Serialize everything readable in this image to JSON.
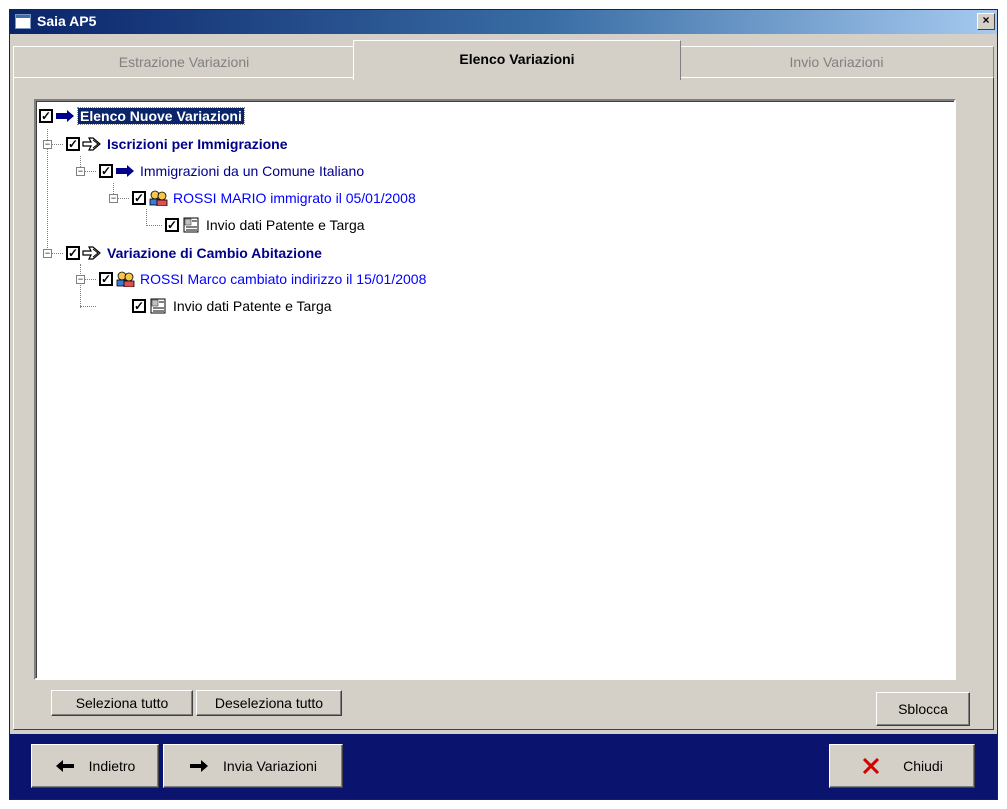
{
  "window": {
    "title": "Saia AP5",
    "close_label": "×"
  },
  "tabs": [
    {
      "label": "Estrazione Variazioni",
      "active": false
    },
    {
      "label": "Elenco Variazioni",
      "active": true
    },
    {
      "label": "Invio Variazioni",
      "active": false
    }
  ],
  "tree": {
    "root": {
      "label": "Elenco Nuove Variazioni",
      "checked": true,
      "icon": "arrow-right-icon"
    },
    "groups": [
      {
        "label": "Iscrizioni per Immigrazione",
        "checked": true,
        "icon": "hand-pointer-icon",
        "sub": {
          "label": "Immigrazioni da un Comune Italiano",
          "checked": true,
          "icon": "arrow-right-icon",
          "person": {
            "label": "ROSSI MARIO immigrato il 05/01/2008",
            "checked": true,
            "icon": "people-icon",
            "action": {
              "label": "Invio dati Patente e Targa",
              "checked": true,
              "icon": "document-icon"
            }
          }
        }
      },
      {
        "label": "Variazione di Cambio Abitazione",
        "checked": true,
        "icon": "hand-pointer-icon",
        "person": {
          "label": "ROSSI Marco cambiato indirizzo il 15/01/2008",
          "checked": true,
          "icon": "people-icon",
          "action": {
            "label": "Invio dati Patente e Targa",
            "checked": true,
            "icon": "document-icon"
          }
        }
      }
    ]
  },
  "buttons": {
    "select_all": "Seleziona tutto",
    "deselect_all": "Deseleziona tutto",
    "unlock": "Sblocca",
    "back": "Indietro",
    "send": "Invia Variazioni",
    "close": "Chiudi"
  },
  "colors": {
    "title_bar": "#0a246a",
    "bottom_bar": "#0a146e",
    "link_blue": "#0000ff",
    "group_navy": "#00008b",
    "close_red": "#d40000"
  }
}
